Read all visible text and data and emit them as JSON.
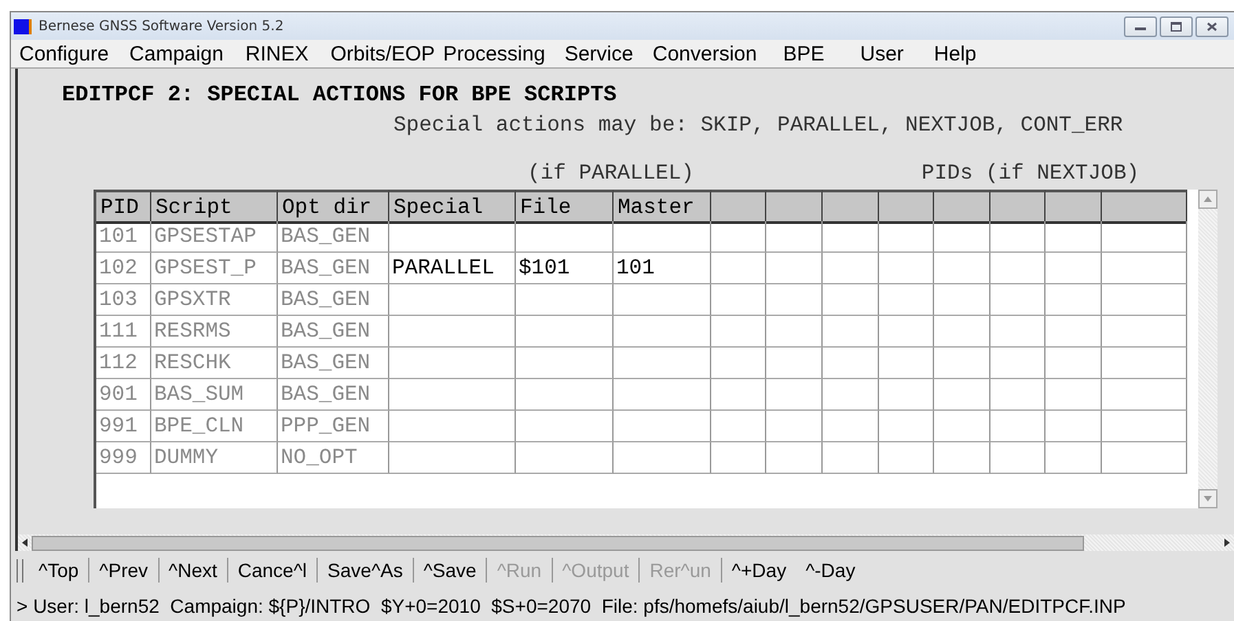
{
  "window": {
    "title": "Bernese GNSS Software Version 5.2"
  },
  "menu": [
    "Configure",
    "Campaign",
    "RINEX",
    "Orbits/EOP",
    "Processing",
    "Service",
    "Conversion",
    "BPE",
    "User",
    "Help"
  ],
  "panel": {
    "title": "EDITPCF 2: SPECIAL ACTIONS FOR BPE SCRIPTS",
    "subtitle": "Special actions may be: SKIP, PARALLEL, NEXTJOB, CONT_ERR",
    "group_parallel": "(if PARALLEL)",
    "group_nextjob": "PIDs (if NEXTJOB)"
  },
  "table": {
    "columns": [
      {
        "label": "PID",
        "readonly": true
      },
      {
        "label": "Script",
        "readonly": true
      },
      {
        "label": "Opt dir",
        "readonly": true
      },
      {
        "label": "Special",
        "readonly": false
      },
      {
        "label": "File",
        "readonly": false
      },
      {
        "label": "Master",
        "readonly": false
      }
    ],
    "rows": [
      {
        "pid": "101",
        "script": "GPSESTAP",
        "opt_dir": "BAS_GEN"
      },
      {
        "pid": "102",
        "script": "GPSEST_P",
        "opt_dir": "BAS_GEN",
        "special": "PARALLEL",
        "file": "$101",
        "master": "101"
      },
      {
        "pid": "103",
        "script": "GPSXTR",
        "opt_dir": "BAS_GEN"
      },
      {
        "pid": "111",
        "script": "RESRMS",
        "opt_dir": "BAS_GEN"
      },
      {
        "pid": "112",
        "script": "RESCHK",
        "opt_dir": "BAS_GEN"
      },
      {
        "pid": "901",
        "script": "BAS_SUM",
        "opt_dir": "BAS_GEN"
      },
      {
        "pid": "991",
        "script": "BPE_CLN",
        "opt_dir": "PPP_GEN"
      },
      {
        "pid": "999",
        "script": "DUMMY",
        "opt_dir": "NO_OPT"
      }
    ]
  },
  "buttons": [
    {
      "label": "^Top",
      "disabled": false,
      "separator": true
    },
    {
      "label": "^Prev",
      "disabled": false,
      "separator": true
    },
    {
      "label": "^Next",
      "disabled": false,
      "separator": true
    },
    {
      "label": "Cance^l",
      "disabled": false,
      "separator": true
    },
    {
      "label": "Save^As",
      "disabled": false,
      "separator": true
    },
    {
      "label": "^Save",
      "disabled": false,
      "separator": true
    },
    {
      "label": "^Run",
      "disabled": true,
      "separator": true
    },
    {
      "label": "^Output",
      "disabled": true,
      "separator": true
    },
    {
      "label": "Rer^un",
      "disabled": true,
      "separator": true
    },
    {
      "label": "^+Day",
      "disabled": false,
      "separator": false
    },
    {
      "label": "^-Day",
      "disabled": false,
      "separator": false
    }
  ],
  "status_bar": "> User: l_bern52  Campaign: ${P}/INTRO  $Y+0=2010  $S+0=2070  File: pfs/homefs/aiub/l_bern52/GPSUSER/PAN/EDITPCF.INP"
}
